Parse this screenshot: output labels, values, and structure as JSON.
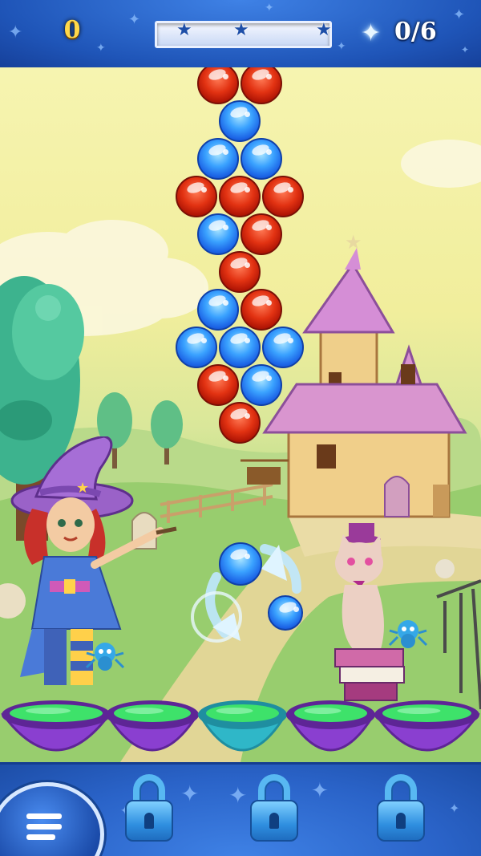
{
  "hud": {
    "score": "0",
    "progress": 0.0,
    "progress_stars": 3,
    "goal_count": "0/6",
    "goal_icon": "star-icon"
  },
  "board": {
    "rows": [
      [
        "red",
        "red"
      ],
      [
        "blue"
      ],
      [
        "blue",
        "blue"
      ],
      [
        "red",
        "red",
        "red"
      ],
      [
        "blue",
        "red"
      ],
      [
        "red"
      ],
      [
        "blue",
        "red"
      ],
      [
        "blue",
        "blue",
        "blue"
      ],
      [
        "red",
        "blue"
      ],
      [
        "red"
      ]
    ]
  },
  "shooter": {
    "current_bubble": "blue",
    "next_bubble": "blue",
    "swap_icon": "swap-arrows-icon"
  },
  "cauldrons": [
    "purple-cauldron",
    "purple-cauldron",
    "teal-cauldron",
    "purple-cauldron",
    "purple-cauldron"
  ],
  "bottom_bar": {
    "menu_icon": "menu-icon",
    "boosters": [
      "lock-icon",
      "lock-icon",
      "lock-icon"
    ]
  },
  "colors": {
    "bubble_red": "#d8300f",
    "bubble_blue": "#2a7cf0",
    "hud_blue": "#1f55b8",
    "potion_green": "#3ee26a"
  }
}
